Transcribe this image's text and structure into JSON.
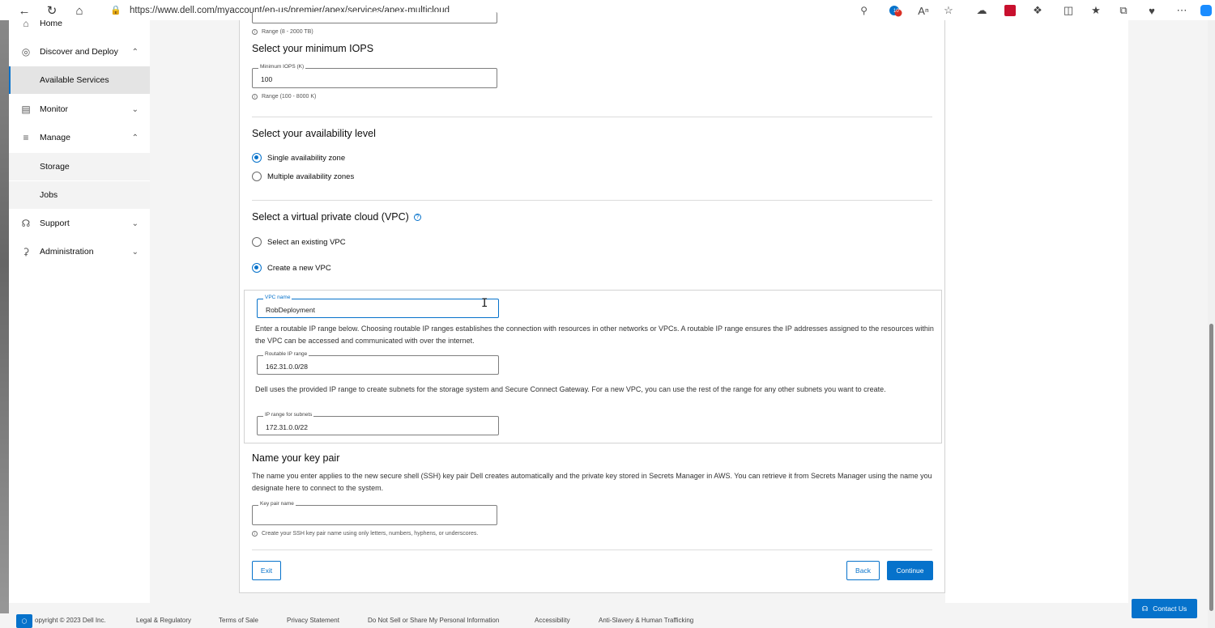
{
  "browser": {
    "url": "https://www.dell.com/myaccount/en-us/premier/apex/services/apex-multicloud",
    "badge_count": "10"
  },
  "sidebar": {
    "items": [
      {
        "label": "Home",
        "icon": "home-icon"
      },
      {
        "label": "Discover and Deploy",
        "icon": "discover-icon"
      },
      {
        "label": "Available Services"
      },
      {
        "label": "Monitor",
        "icon": "monitor-icon"
      },
      {
        "label": "Manage",
        "icon": "manage-icon"
      },
      {
        "label": "Storage"
      },
      {
        "label": "Jobs"
      },
      {
        "label": "Support",
        "icon": "headset-icon"
      },
      {
        "label": "Administration",
        "icon": "key-icon"
      }
    ]
  },
  "form": {
    "capacity_range": "Range (8 - 2000 TB)",
    "iops_heading": "Select your minimum IOPS",
    "iops_label": "Minimum IOPS (K)",
    "iops_value": "100",
    "iops_range": "Range (100 - 8000 K)",
    "availability_heading": "Select your availability level",
    "availability_options": [
      "Single availability zone",
      "Multiple availability zones"
    ],
    "availability_selected": 0,
    "vpc_heading": "Select a virtual private cloud (VPC)",
    "vpc_options": [
      "Select an existing VPC",
      "Create a new VPC"
    ],
    "vpc_selected": 1,
    "vpc_name_label": "VPC name",
    "vpc_name_value": "RobDeployment",
    "routable_desc": "Enter a routable IP range below. Choosing routable IP ranges establishes the connection with resources in other networks or VPCs. A routable IP range ensures the IP addresses assigned to the resources within the VPC can be accessed and communicated with over the internet.",
    "routable_label": "Routable IP range",
    "routable_value": "162.31.0.0/28",
    "subnet_desc": "Dell uses the provided IP range to create subnets for the storage system and Secure Connect Gateway. For a new VPC, you can use the rest of the range for any other subnets you want to create.",
    "subnet_label": "IP range for subnets",
    "subnet_value": "172.31.0.0/22",
    "keypair_heading": "Name your key pair",
    "keypair_desc": "The name you enter applies to the new secure shell (SSH) key pair Dell creates automatically and the private key stored in Secrets Manager in AWS. You can retrieve it from Secrets Manager using the name you designate here to connect to the system.",
    "keypair_label": "Key pair name",
    "keypair_value": "",
    "keypair_hint": "Create your SSH key pair name using only letters, numbers, hyphens, or underscores."
  },
  "buttons": {
    "exit": "Exit",
    "back": "Back",
    "continue": "Continue"
  },
  "footer": {
    "copyright": "opyright © 2023 Dell Inc.",
    "links": [
      "Legal & Regulatory",
      "Terms of Sale",
      "Privacy Statement",
      "Do Not Sell or Share My Personal Information",
      "Accessibility",
      "Anti-Slavery & Human Trafficking"
    ],
    "contact": "Contact Us"
  },
  "colors": {
    "accent": "#0672cb",
    "page_bg": "#f4f4f4"
  }
}
